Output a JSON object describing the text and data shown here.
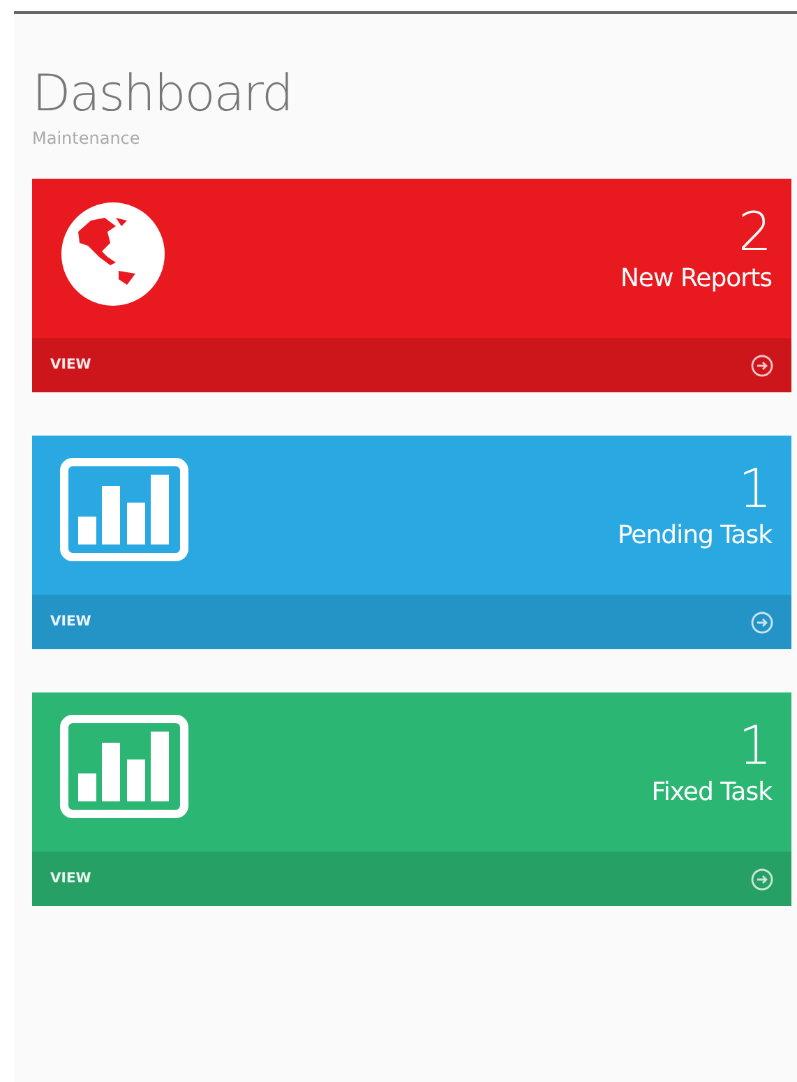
{
  "header": {
    "title": "Dashboard",
    "subtitle": "Maintenance"
  },
  "cards": [
    {
      "kind": "globe",
      "color": "#e8191f",
      "count": "2",
      "label": "New Reports",
      "link": "VIEW"
    },
    {
      "kind": "chart",
      "color": "#29a8e2",
      "count": "1",
      "label": "Pending Task",
      "link": "VIEW"
    },
    {
      "kind": "chart",
      "color": "#2bb673",
      "count": "1",
      "label": "Fixed Task",
      "link": "VIEW"
    }
  ]
}
